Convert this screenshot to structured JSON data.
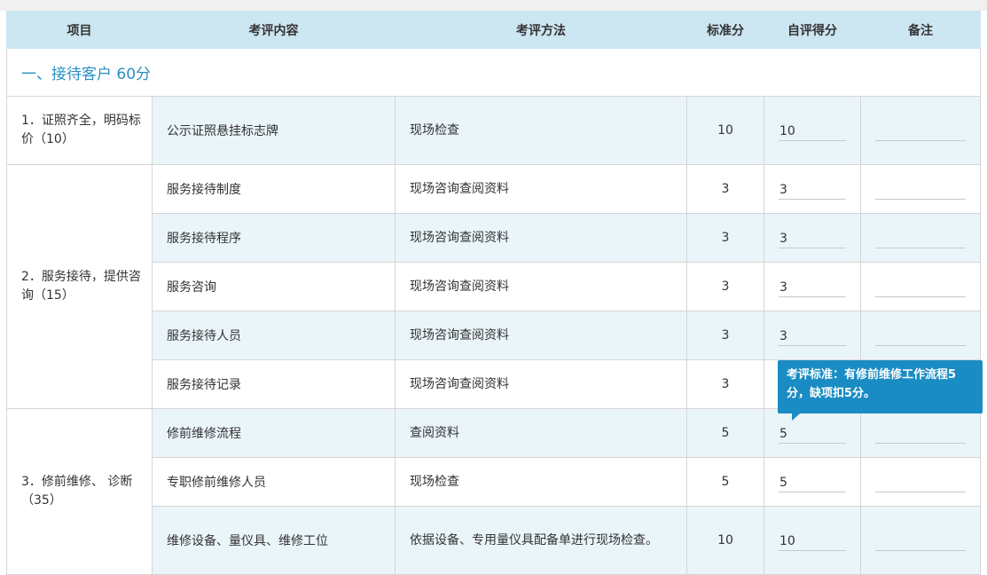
{
  "headers": {
    "item": "项目",
    "content": "考评内容",
    "method": "考评方法",
    "standard": "标准分",
    "self_score": "自评得分",
    "note": "备注"
  },
  "section1": {
    "title": "一、接待客户 60分"
  },
  "groups": {
    "g1": {
      "label": "1．证照齐全，明码标价（10）"
    },
    "g2": {
      "label": "2．服务接待，提供咨询（15）"
    },
    "g3": {
      "label": "3．修前维修、 诊断（35）"
    }
  },
  "rows": [
    {
      "content": "公示证照悬挂标志牌",
      "method": "现场检查",
      "standard": "10",
      "self_score": "10",
      "note": ""
    },
    {
      "content": "服务接待制度",
      "method": "现场咨询查阅资料",
      "standard": "3",
      "self_score": "3",
      "note": ""
    },
    {
      "content": "服务接待程序",
      "method": "现场咨询查阅资料",
      "standard": "3",
      "self_score": "3",
      "note": ""
    },
    {
      "content": "服务咨询",
      "method": "现场咨询查阅资料",
      "standard": "3",
      "self_score": "3",
      "note": ""
    },
    {
      "content": "服务接待人员",
      "method": "现场咨询查阅资料",
      "standard": "3",
      "self_score": "3",
      "note": ""
    },
    {
      "content": "服务接待记录",
      "method": "现场咨询查阅资料",
      "standard": "3",
      "self_score": "",
      "note": ""
    },
    {
      "content": "修前维修流程",
      "method": "查阅资料",
      "standard": "5",
      "self_score": "5",
      "note": ""
    },
    {
      "content": "专职修前维修人员",
      "method": "现场检查",
      "standard": "5",
      "self_score": "5",
      "note": ""
    },
    {
      "content": "维修设备、量仪具、维修工位",
      "method": "依据设备、专用量仪具配备单进行现场检查。",
      "standard": "10",
      "self_score": "10",
      "note": ""
    }
  ],
  "tooltip": {
    "text": "考评标准：有修前维修工作流程5分，缺项扣5分。"
  },
  "colors": {
    "header_bg": "#cce6f2",
    "row_alt_bg": "#eaf5fa",
    "section_title": "#2a8fc4",
    "tooltip_bg": "#1a8cc4"
  }
}
